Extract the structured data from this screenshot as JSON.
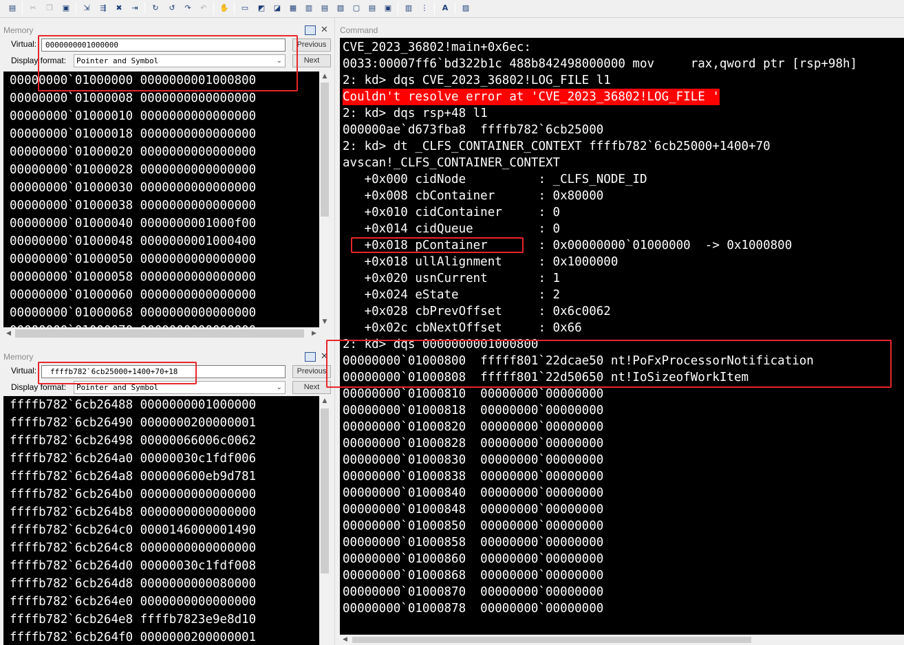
{
  "toolbar": {
    "icons": [
      "open-icon",
      "cut-icon",
      "copy-icon",
      "paste-icon",
      "step-into-icon",
      "step-over-icon",
      "step-out-icon",
      "run-to-cursor-icon",
      "go-icon",
      "restart-icon",
      "stop-icon",
      "break-icon",
      "source-mode-icon",
      "hand-icon",
      "command-window-icon",
      "watch-icon",
      "locals-icon",
      "registers-icon",
      "memory-icon",
      "call-stack-icon",
      "disassembly-icon",
      "scratch-pad-icon",
      "processes-icon",
      "source-icon",
      "hex-icon",
      "font-icon",
      "options-icon"
    ]
  },
  "memory_top": {
    "title": "Memory",
    "virtual_label": "Virtual:",
    "address": "0000000001000000",
    "display_format_label": "Display format:",
    "format": "Pointer and Symbol",
    "previous": "Previous",
    "next": "Next",
    "rows": [
      "00000000`01000000 0000000001000800",
      "00000000`01000008 0000000000000000",
      "00000000`01000010 0000000000000000",
      "00000000`01000018 0000000000000000",
      "00000000`01000020 0000000000000000",
      "00000000`01000028 0000000000000000",
      "00000000`01000030 0000000000000000",
      "00000000`01000038 0000000000000000",
      "00000000`01000040 0000000001000f00",
      "00000000`01000048 0000000001000400",
      "00000000`01000050 0000000000000000",
      "00000000`01000058 0000000000000000",
      "00000000`01000060 0000000000000000",
      "00000000`01000068 0000000000000000",
      "00000000`01000070 0000000000000000"
    ]
  },
  "memory_bottom": {
    "title": "Memory",
    "virtual_label": "Virtual:",
    "address": "ffffb782`6cb25000+1400+70+18",
    "display_format_label": "Display format:",
    "format": "Pointer and Symbol",
    "previous": "Previous",
    "next": "Next",
    "rows": [
      "ffffb782`6cb26488 0000000001000000",
      "ffffb782`6cb26490 0000000200000001",
      "ffffb782`6cb26498 00000066006c0062",
      "ffffb782`6cb264a0 00000030c1fdf006",
      "ffffb782`6cb264a8 000000600eb9d781",
      "ffffb782`6cb264b0 0000000000000000",
      "ffffb782`6cb264b8 0000000000000000",
      "ffffb782`6cb264c0 0000146000001490",
      "ffffb782`6cb264c8 0000000000000000",
      "ffffb782`6cb264d0 00000030c1fdf008",
      "ffffb782`6cb264d8 0000000000080000",
      "ffffb782`6cb264e0 0000000000000000",
      "ffffb782`6cb264e8 ffffb7823e9e8d10",
      "ffffb782`6cb264f0 0000000200000001",
      "ffffb782`6cb264f8 0000000000000000"
    ]
  },
  "command": {
    "title": "Command",
    "lines": [
      {
        "text": "CVE_2023_36802!main+0x6ec:",
        "err": false
      },
      {
        "text": "0033:00007ff6`bd322b1c 488b842498000000 mov     rax,qword ptr [rsp+98h]",
        "err": false
      },
      {
        "text": "2: kd> dqs CVE_2023_36802!LOG_FILE l1",
        "err": false
      },
      {
        "text": "Couldn't resolve error at 'CVE_2023_36802!LOG_FILE '",
        "err": true
      },
      {
        "text": "2: kd> dqs rsp+48 l1",
        "err": false
      },
      {
        "text": "000000ae`d673fba8  ffffb782`6cb25000",
        "err": false
      },
      {
        "text": "2: kd> dt _CLFS_CONTAINER_CONTEXT ffffb782`6cb25000+1400+70",
        "err": false
      },
      {
        "text": "avscan!_CLFS_CONTAINER_CONTEXT",
        "err": false
      },
      {
        "text": "   +0x000 cidNode          : _CLFS_NODE_ID",
        "err": false
      },
      {
        "text": "   +0x008 cbContainer      : 0x80000",
        "err": false
      },
      {
        "text": "   +0x010 cidContainer     : 0",
        "err": false
      },
      {
        "text": "   +0x014 cidQueue         : 0",
        "err": false
      },
      {
        "text": "   +0x018 pContainer       : 0x00000000`01000000  -> 0x1000800",
        "err": false
      },
      {
        "text": "   +0x018 ullAlignment     : 0x1000000",
        "err": false
      },
      {
        "text": "   +0x020 usnCurrent       : 1",
        "err": false
      },
      {
        "text": "   +0x024 eState           : 2",
        "err": false
      },
      {
        "text": "   +0x028 cbPrevOffset     : 0x6c0062",
        "err": false
      },
      {
        "text": "   +0x02c cbNextOffset     : 0x66",
        "err": false
      },
      {
        "text": "2: kd> dqs 0000000001000800",
        "err": false
      },
      {
        "text": "00000000`01000800  fffff801`22dcae50 nt!PoFxProcessorNotification",
        "err": false
      },
      {
        "text": "00000000`01000808  fffff801`22d50650 nt!IoSizeofWorkItem",
        "err": false
      },
      {
        "text": "00000000`01000810  00000000`00000000",
        "err": false
      },
      {
        "text": "00000000`01000818  00000000`00000000",
        "err": false
      },
      {
        "text": "00000000`01000820  00000000`00000000",
        "err": false
      },
      {
        "text": "00000000`01000828  00000000`00000000",
        "err": false
      },
      {
        "text": "00000000`01000830  00000000`00000000",
        "err": false
      },
      {
        "text": "00000000`01000838  00000000`00000000",
        "err": false
      },
      {
        "text": "00000000`01000840  00000000`00000000",
        "err": false
      },
      {
        "text": "00000000`01000848  00000000`00000000",
        "err": false
      },
      {
        "text": "00000000`01000850  00000000`00000000",
        "err": false
      },
      {
        "text": "00000000`01000858  00000000`00000000",
        "err": false
      },
      {
        "text": "00000000`01000860  00000000`00000000",
        "err": false
      },
      {
        "text": "00000000`01000868  00000000`00000000",
        "err": false
      },
      {
        "text": "00000000`01000870  00000000`00000000",
        "err": false
      },
      {
        "text": "00000000`01000878  00000000`00000000",
        "err": false
      }
    ]
  },
  "colors": {
    "console_bg": "#000000",
    "console_fg": "#ffffff",
    "error_bg": "#ff0000",
    "annotation": "#e8262a"
  }
}
